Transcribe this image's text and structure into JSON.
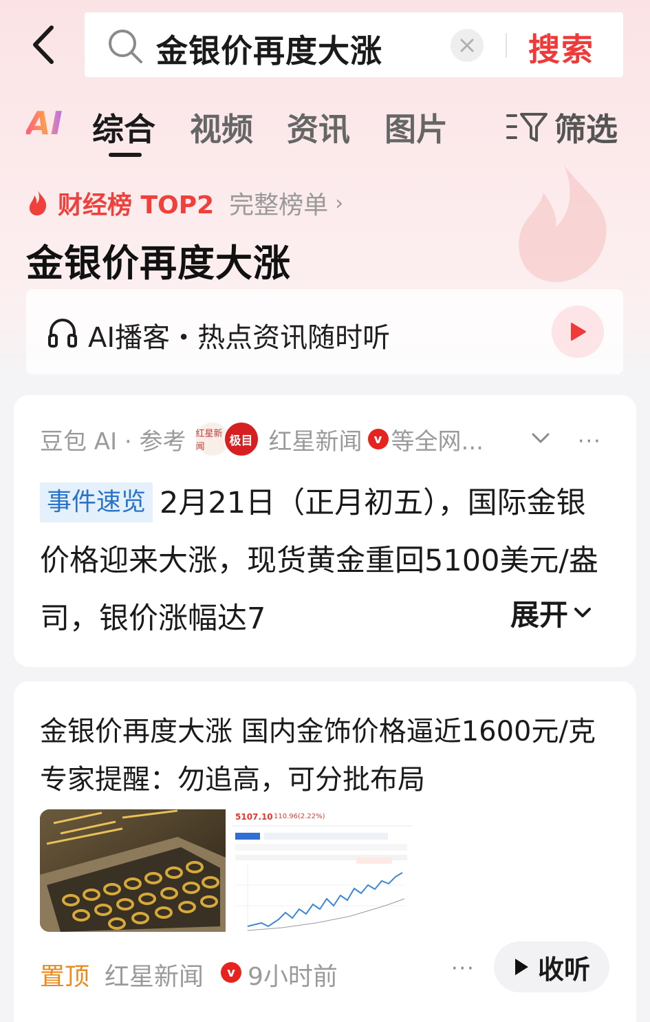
{
  "header": {
    "search_query": "金银价再度大涨",
    "search_button": "搜索"
  },
  "tabs": {
    "ai_label": "AI",
    "items": [
      {
        "label": "综合",
        "active": true
      },
      {
        "label": "视频",
        "active": false
      },
      {
        "label": "资讯",
        "active": false
      },
      {
        "label": "图片",
        "active": false
      }
    ],
    "filter_label": "筛选"
  },
  "ranking": {
    "badge": "财经榜 TOP2",
    "full_list_link": "完整榜单",
    "chevron": "›"
  },
  "topic": {
    "title": "金银价再度大涨"
  },
  "podcast": {
    "text": "AI播客・热点资讯随时听",
    "icon": "headphones-icon",
    "play_icon": "play-icon"
  },
  "ai_card": {
    "meta_prefix": "豆包 AI · 参考",
    "logo_a_text": "红星新闻",
    "logo_b_text": "极目",
    "source": "红星新闻",
    "verified": "v",
    "more_sources": "等全网...",
    "event_tag": "事件速览",
    "summary_text": "2月21日（正月初五），国际金银价格迎来大涨，现货黄金重回5100美元/盎司，银价涨幅达7",
    "expand_label": "展开"
  },
  "article_card": {
    "title": "金银价再度大涨 国内金饰价格逼近1600元/克 专家提醒：勿追高，可分批布局",
    "chart_thumb": {
      "price": "5107.10",
      "change": "110.96(2.22%)"
    },
    "pinned_label": "置顶",
    "source": "红星新闻",
    "verified": "v",
    "time": "9小时前",
    "more": "···",
    "listen_label": "收听"
  },
  "colors": {
    "accent_red": "#f03a3a",
    "pinned_orange": "#e98a1c",
    "tag_blue": "#2a73c8"
  }
}
